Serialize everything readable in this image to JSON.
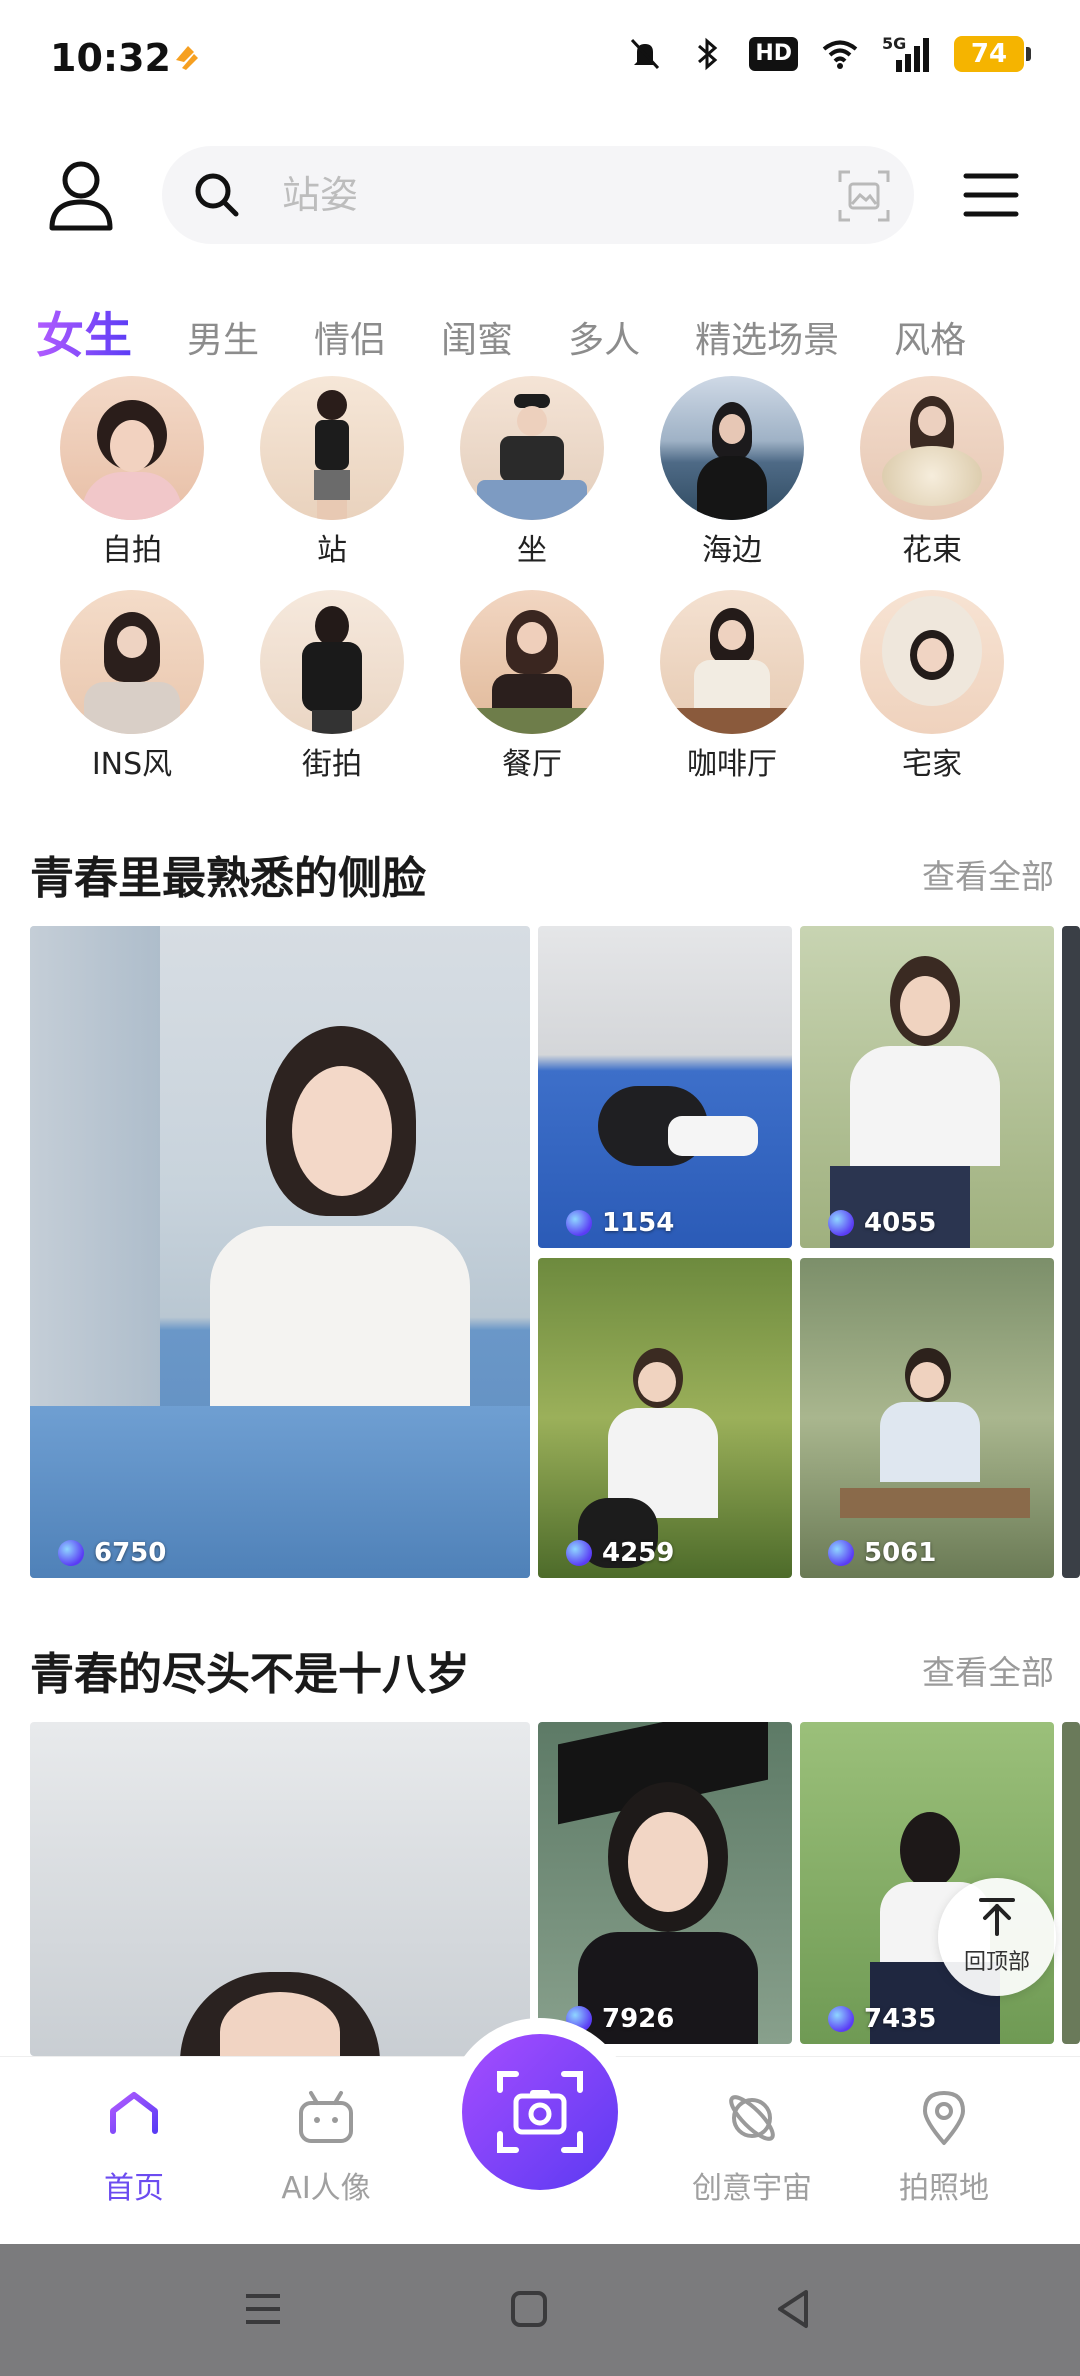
{
  "status_bar": {
    "time": "10:32",
    "network": "5G",
    "hd": "HD",
    "battery": "74"
  },
  "search": {
    "placeholder": "站姿"
  },
  "tabs": [
    "女生",
    "男生",
    "情侣",
    "闺蜜",
    "多人",
    "精选场景",
    "风格"
  ],
  "active_tab": "女生",
  "poses": [
    {
      "label": "自拍"
    },
    {
      "label": "站"
    },
    {
      "label": "坐"
    },
    {
      "label": "海边"
    },
    {
      "label": "花束"
    },
    {
      "label": "INS风"
    },
    {
      "label": "街拍"
    },
    {
      "label": "餐厅"
    },
    {
      "label": "咖啡厅"
    },
    {
      "label": "宅家"
    }
  ],
  "sections": [
    {
      "title": "青春里最熟悉的侧脸",
      "see_all": "查看全部",
      "photos": [
        {
          "count": "6750"
        },
        {
          "count": "1154"
        },
        {
          "count": "4055"
        },
        {
          "count": "4259"
        },
        {
          "count": "5061"
        }
      ]
    },
    {
      "title": "青春的尽头不是十八岁",
      "see_all": "查看全部",
      "photos": [
        {
          "count": ""
        },
        {
          "count": "7926"
        },
        {
          "count": "7435"
        }
      ]
    }
  ],
  "back_to_top": "回顶部",
  "bottom_nav": [
    {
      "label": "首页",
      "icon": "home-icon",
      "active": true
    },
    {
      "label": "AI人像",
      "icon": "ai-robot-icon",
      "active": false
    },
    {
      "label": "创意宇宙",
      "icon": "planet-icon",
      "active": false
    },
    {
      "label": "拍照地",
      "icon": "location-pin-icon",
      "active": false
    }
  ],
  "colors": {
    "accent": "#6c4cf0",
    "accent_light": "#b25cff",
    "fab_start": "#a64dff",
    "fab_end": "#5b3af2",
    "system_bar": "#7b7b7d"
  }
}
